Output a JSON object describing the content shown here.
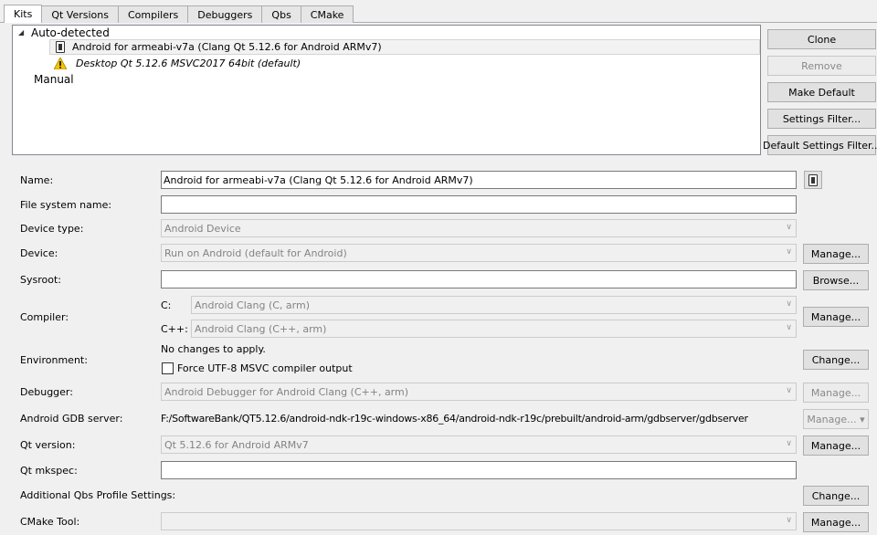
{
  "tabs": [
    "Kits",
    "Qt Versions",
    "Compilers",
    "Debuggers",
    "Qbs",
    "CMake"
  ],
  "tree": {
    "auto_detected": "Auto-detected",
    "kits": [
      "Android for armeabi-v7a (Clang Qt 5.12.6 for Android ARMv7)",
      "Desktop Qt 5.12.6 MSVC2017 64bit (default)"
    ],
    "manual": "Manual"
  },
  "side_buttons": {
    "clone": "Clone",
    "remove": "Remove",
    "make_default": "Make Default",
    "settings_filter": "Settings Filter...",
    "default_settings_filter": "Default Settings Filter..."
  },
  "form": {
    "name_label": "Name:",
    "name_value": "Android for armeabi-v7a (Clang Qt 5.12.6 for Android ARMv7)",
    "fs_name_label": "File system name:",
    "fs_name_value": "",
    "device_type_label": "Device type:",
    "device_type_value": "Android Device",
    "device_label": "Device:",
    "device_value": "Run on Android (default for Android)",
    "sysroot_label": "Sysroot:",
    "sysroot_value": "",
    "compiler_label": "Compiler:",
    "c_label": "C:",
    "c_value": "Android Clang (C, arm)",
    "cpp_label": "C++:",
    "cpp_value": "Android Clang (C++, arm)",
    "environment_label": "Environment:",
    "environment_text": "No changes to apply.",
    "utf8_label": "Force UTF-8 MSVC compiler output",
    "debugger_label": "Debugger:",
    "debugger_value": "Android Debugger for Android Clang (C++, arm)",
    "gdb_label": "Android GDB server:",
    "gdb_value": "F:/SoftwareBank/QT5.12.6/android-ndk-r19c-windows-x86_64/android-ndk-r19c/prebuilt/android-arm/gdbserver/gdbserver",
    "qt_version_label": "Qt version:",
    "qt_version_value": "Qt 5.12.6 for Android ARMv7",
    "mkspec_label": "Qt mkspec:",
    "mkspec_value": "",
    "qbs_label": "Additional Qbs Profile Settings:",
    "cmake_label": "CMake Tool:",
    "cmake_value": ""
  },
  "buttons": {
    "manage": "Manage...",
    "browse": "Browse...",
    "change": "Change...",
    "manage_dropdown": "Manage... ▾"
  },
  "icons": {
    "expand": "◢",
    "combo_chevron": "∨"
  }
}
